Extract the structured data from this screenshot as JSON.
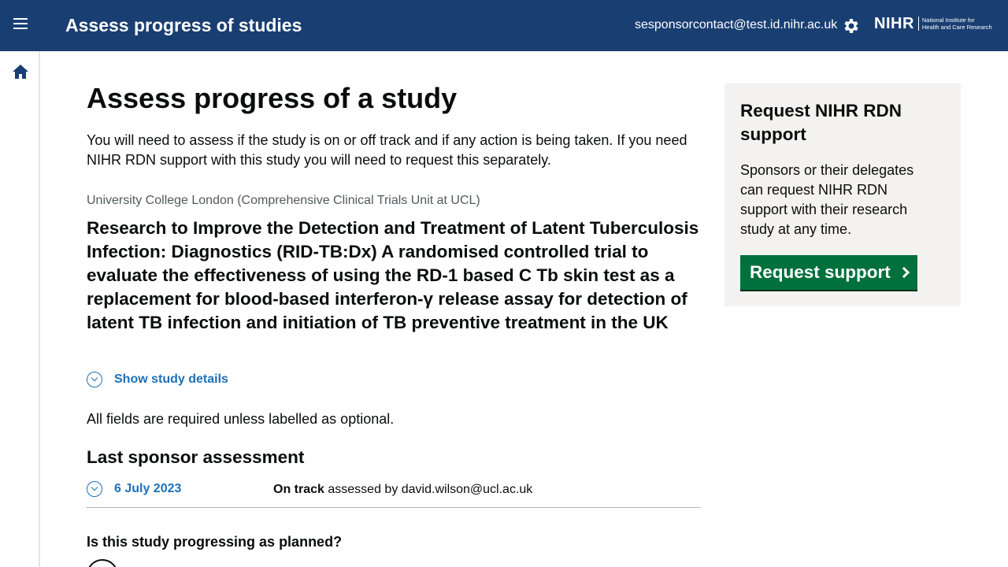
{
  "header": {
    "app_title": "Assess progress of studies",
    "user_email": "sesponsorcontact@test.id.nihr.ac.uk",
    "logo_main": "NIHR",
    "logo_sub_line1": "National Institute for",
    "logo_sub_line2": "Health and Care Research"
  },
  "sidebar": {
    "home_icon": "home-icon"
  },
  "main": {
    "page_title": "Assess progress of a study",
    "intro": "You will need to assess if the study is on or off track and if any action is being taken. If you need NIHR RDN support with this study you will need to request this separately.",
    "organisation": "University College London (Comprehensive Clinical Trials Unit at UCL)",
    "study_title": "Research to Improve the Detection and Treatment of Latent Tuberculosis Infection: Diagnostics (RID-TB:Dx) A randomised controlled trial to evaluate the effectiveness of using the RD-1 based C Tb skin test as a replacement for blood-based interferon-γ release assay for detection of latent TB infection and initiation of TB preventive treatment in the UK",
    "show_details": "Show study details",
    "required_note": "All fields are required unless labelled as optional.",
    "last_assessment_heading": "Last sponsor assessment",
    "last_assessment": {
      "date": "6 July 2023",
      "status": "On track",
      "assessed_by_text": "assessed by david.wilson@ucl.ac.uk"
    },
    "question": "Is this study progressing as planned?"
  },
  "side_panel": {
    "title": "Request NIHR RDN support",
    "text": "Sponsors or their delegates can request NIHR RDN support with their research study at any time.",
    "button_label": "Request support"
  },
  "colors": {
    "header_bg": "#193e72",
    "link": "#1d70b8",
    "button_green": "#00703c",
    "panel_bg": "#f3f2f1"
  }
}
